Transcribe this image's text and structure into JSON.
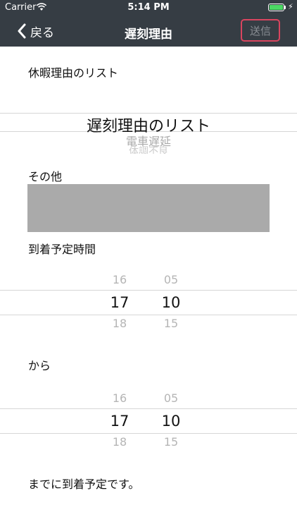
{
  "status_bar": {
    "carrier": "Carrier",
    "time": "5:14 PM"
  },
  "nav": {
    "back_label": "戻る",
    "title": "遅刻理由",
    "send_label": "送信"
  },
  "reason_list_label": "休暇理由のリスト",
  "reason_picker": {
    "options": [
      "遅刻理由のリスト",
      "電車遅延",
      "体調不良"
    ],
    "selected": "遅刻理由のリスト"
  },
  "other_label": "その他",
  "other_text": "",
  "arrival_label": "到着予定時間",
  "arrival_picker": {
    "hours": [
      "16",
      "17",
      "18"
    ],
    "minutes": [
      "05",
      "10",
      "15"
    ],
    "selected_hour": "17",
    "selected_minute": "10"
  },
  "from_label": "から",
  "from_picker": {
    "hours": [
      "16",
      "17",
      "18"
    ],
    "minutes": [
      "05",
      "10",
      "15"
    ],
    "selected_hour": "17",
    "selected_minute": "10"
  },
  "footer_text": "までに到着予定です。",
  "colors": {
    "bar": "#363d44",
    "send_border": "#d9455f",
    "text_area": "#aaaaaa",
    "battery": "#4cd964"
  }
}
